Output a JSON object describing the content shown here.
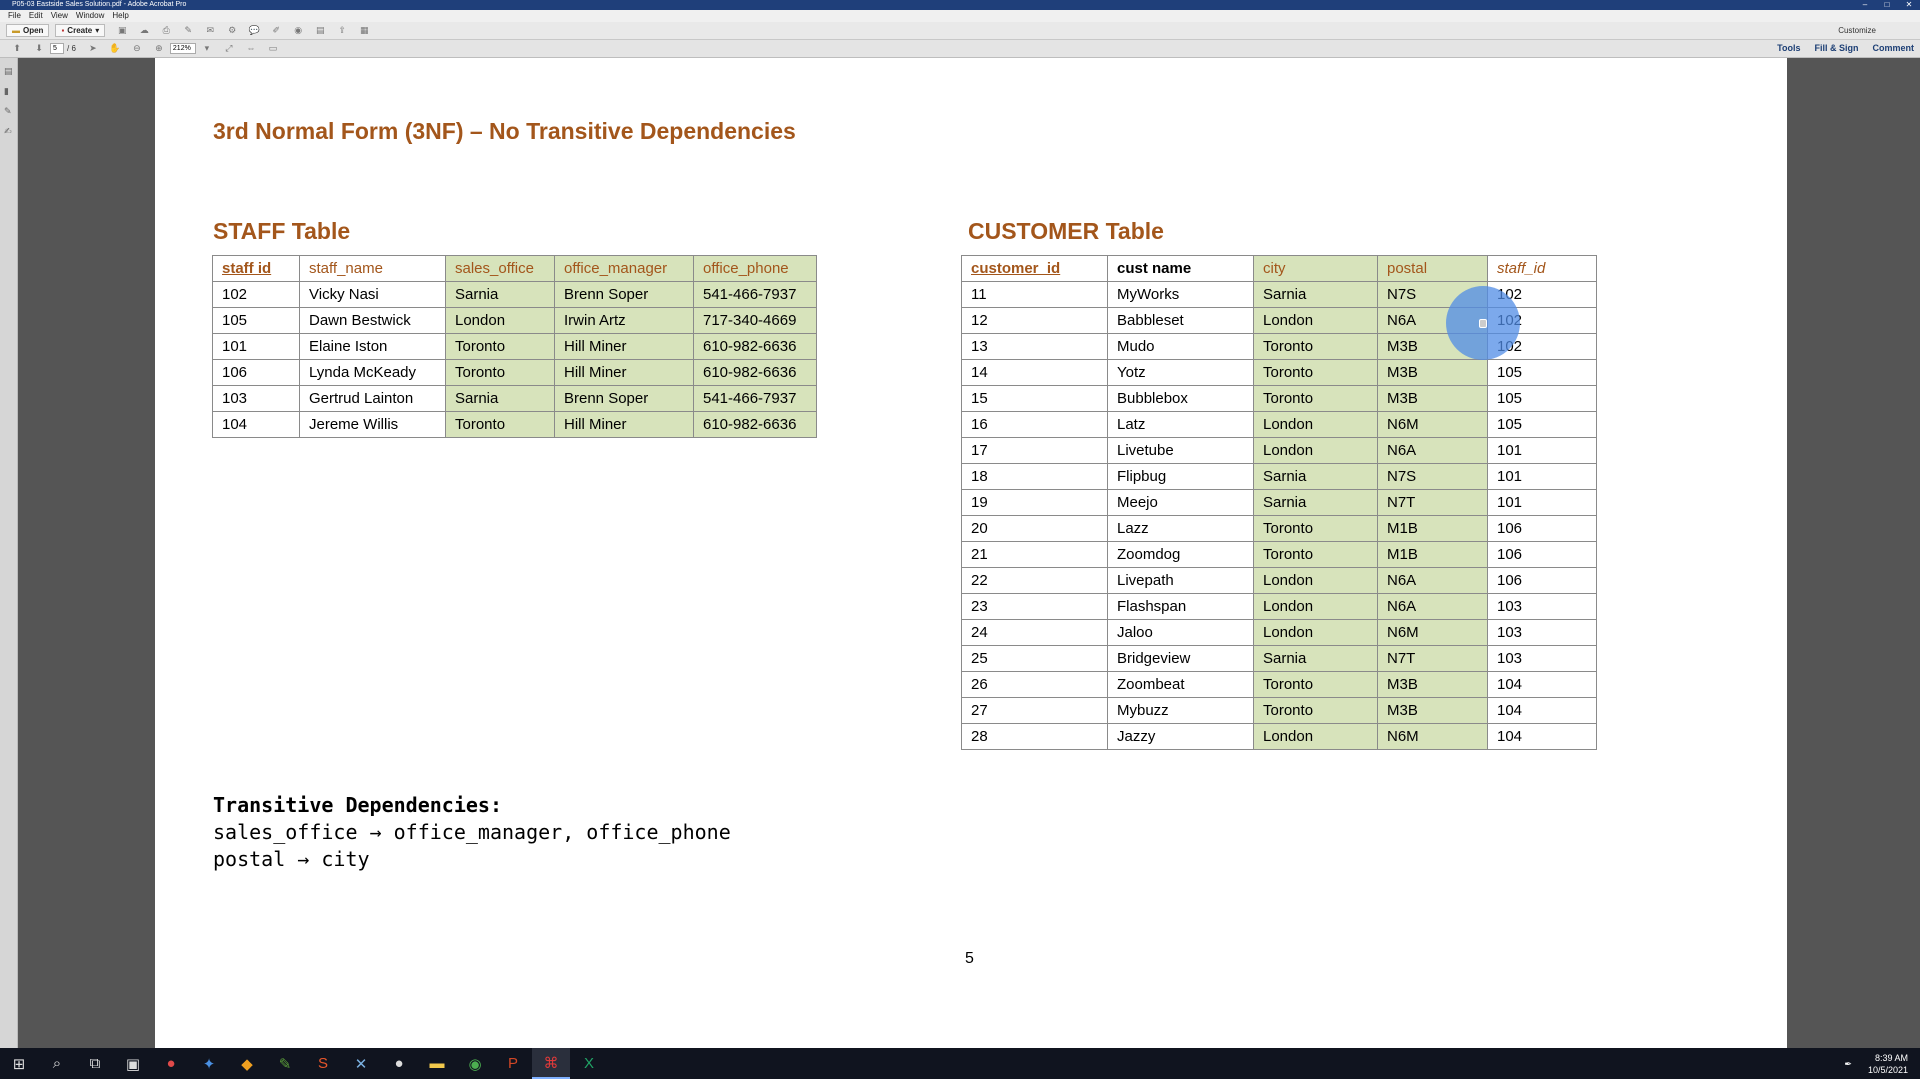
{
  "window": {
    "title": "P05-03 Eastside Sales Solution.pdf - Adobe Acrobat Pro"
  },
  "menu": [
    "File",
    "Edit",
    "View",
    "Window",
    "Help"
  ],
  "toolbar": {
    "open_label": "Open",
    "create_label": "Create",
    "customize_label": "Customize"
  },
  "nav": {
    "page_current": "5",
    "page_total": "/ 6",
    "zoom": "212%"
  },
  "right_tools": [
    "Tools",
    "Fill & Sign",
    "Comment"
  ],
  "page": {
    "title": "3rd Normal Form (3NF) – No Transitive Dependencies",
    "page_number": "5"
  },
  "staff": {
    "title": "STAFF Table",
    "headers": [
      "staff id",
      "staff_name",
      "sales_office",
      "office_manager",
      "office_phone"
    ],
    "rows": [
      [
        "102",
        "Vicky Nasi",
        "Sarnia",
        "Brenn Soper",
        "541-466-7937"
      ],
      [
        "105",
        "Dawn Bestwick",
        "London",
        "Irwin Artz",
        "717-340-4669"
      ],
      [
        "101",
        "Elaine Iston",
        "Toronto",
        "Hill Miner",
        "610-982-6636"
      ],
      [
        "106",
        "Lynda McKeady",
        "Toronto",
        "Hill Miner",
        "610-982-6636"
      ],
      [
        "103",
        "Gertrud Lainton",
        "Sarnia",
        "Brenn Soper",
        "541-466-7937"
      ],
      [
        "104",
        "Jereme Willis",
        "Toronto",
        "Hill Miner",
        "610-982-6636"
      ]
    ]
  },
  "customer": {
    "title": "CUSTOMER Table",
    "headers": [
      "customer_id",
      "cust name",
      "city",
      "postal",
      "staff_id"
    ],
    "rows": [
      [
        "11",
        "MyWorks",
        "Sarnia",
        "N7S",
        "102"
      ],
      [
        "12",
        "Babbleset",
        "London",
        "N6A",
        "102"
      ],
      [
        "13",
        "Mudo",
        "Toronto",
        "M3B",
        "102"
      ],
      [
        "14",
        "Yotz",
        "Toronto",
        "M3B",
        "105"
      ],
      [
        "15",
        "Bubblebox",
        "Toronto",
        "M3B",
        "105"
      ],
      [
        "16",
        "Latz",
        "London",
        "N6M",
        "105"
      ],
      [
        "17",
        "Livetube",
        "London",
        "N6A",
        "101"
      ],
      [
        "18",
        "Flipbug",
        "Sarnia",
        "N7S",
        "101"
      ],
      [
        "19",
        "Meejo",
        "Sarnia",
        "N7T",
        "101"
      ],
      [
        "20",
        "Lazz",
        "Toronto",
        "M1B",
        "106"
      ],
      [
        "21",
        "Zoomdog",
        "Toronto",
        "M1B",
        "106"
      ],
      [
        "22",
        "Livepath",
        "London",
        "N6A",
        "106"
      ],
      [
        "23",
        "Flashspan",
        "London",
        "N6A",
        "103"
      ],
      [
        "24",
        "Jaloo",
        "London",
        "N6M",
        "103"
      ],
      [
        "25",
        "Bridgeview",
        "Sarnia",
        "N7T",
        "103"
      ],
      [
        "26",
        "Zoombeat",
        "Toronto",
        "M3B",
        "104"
      ],
      [
        "27",
        "Mybuzz",
        "Toronto",
        "M3B",
        "104"
      ],
      [
        "28",
        "Jazzy",
        "London",
        "N6M",
        "104"
      ]
    ]
  },
  "transitive": {
    "heading": "Transitive Dependencies:",
    "lines": [
      "sales_office → office_manager, office_phone",
      "postal → city"
    ]
  },
  "taskbar": {
    "time": "8:39 AM",
    "date": "10/5/2021"
  },
  "colors": {
    "heading": "#a3561b",
    "highlight": "#d7e3bb"
  }
}
